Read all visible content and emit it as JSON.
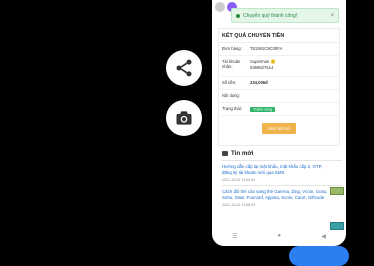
{
  "toast": {
    "message": "Chuyển quỹ thành công!",
    "close": "×"
  },
  "result": {
    "title": "KẾT QUẢ CHUYỂN TIỀN",
    "rows": [
      {
        "label": "Đơn hàng:",
        "value": "T61591C9C00FA"
      },
      {
        "label": "Tài khoản nhận:",
        "value": "Superman 🙂\n0369627514"
      },
      {
        "label": "Số tiền:",
        "value": "234,006đ"
      },
      {
        "label": "Nội dung:",
        "value": ""
      },
      {
        "label": "Trạng thái:",
        "value": "Thành công"
      }
    ],
    "button": "Xem lịch sử"
  },
  "news": {
    "title": "Tin mới",
    "items": [
      {
        "title": "Hướng dẫn cấp lại mật khẩu, mật khẩu cấp 2, OTP, đăng ký tài khoản mới qua SMS",
        "date": "2021-10-02 11:09:44"
      },
      {
        "title": "Cách đổi thẻ cào sang thẻ Garena, Zing, Vcoin, Gosu, Sohu, Gate, Funcard, Appota, Scoin, Carot, Giftcode",
        "date": "2021-10-02 11:08:23"
      }
    ]
  },
  "nav": {
    "recent": "☰",
    "home": "●",
    "back": "◀"
  },
  "colors": {
    "accent": "#f0b44c",
    "success": "#2eb56b",
    "link": "#1a69c9"
  }
}
